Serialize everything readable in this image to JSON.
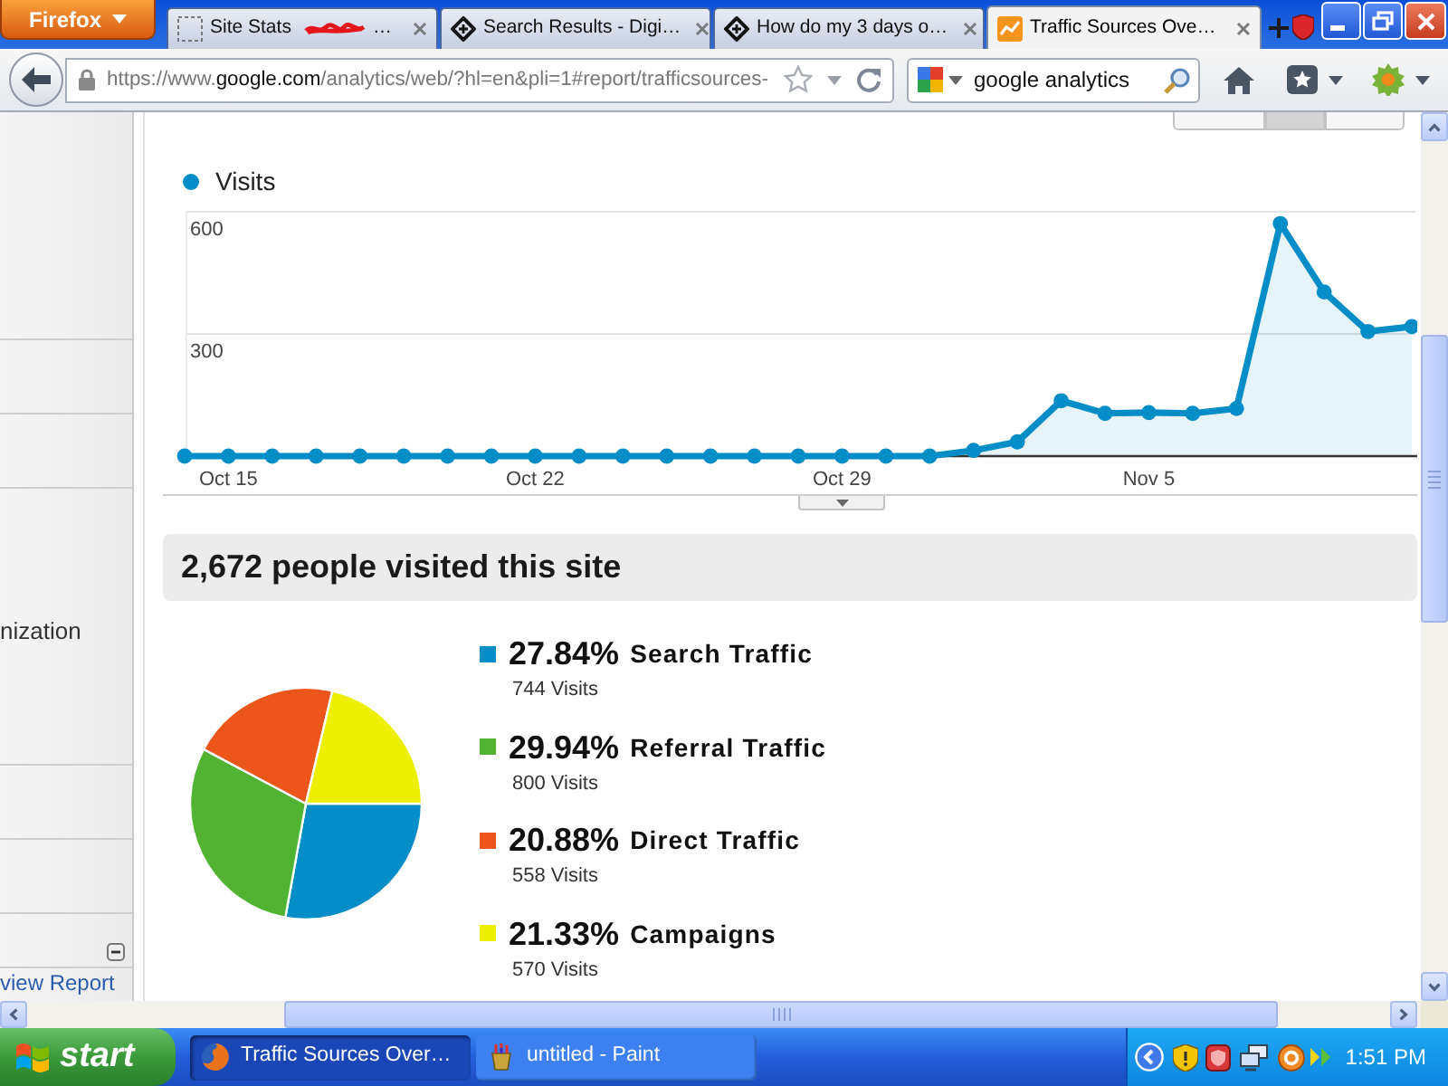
{
  "browser": {
    "menu_button": "Firefox",
    "tabs": [
      {
        "kind": "blank",
        "title": "Site Stats",
        "redacted": true,
        "tail": "…",
        "selected": false
      },
      {
        "kind": "diamond",
        "title": "Search Results - Digi…",
        "selected": false
      },
      {
        "kind": "diamond",
        "title": "How do my 3 days o…",
        "selected": false
      },
      {
        "kind": "chart",
        "title": "Traffic Sources Ove…",
        "selected": true
      }
    ],
    "address": {
      "scheme": "https://www.",
      "domain": "google.com",
      "path": "/analytics/web/?hl=en&pli=1#report/trafficsources-"
    },
    "search": {
      "value": "google analytics"
    }
  },
  "sidebar": {
    "item": "nization",
    "section_expanded": true,
    "link": "view Report"
  },
  "visits": {
    "view_toggle": [
      {
        "selected": false
      },
      {
        "selected": true
      },
      {
        "selected": false
      }
    ],
    "chart_data": {
      "type": "area",
      "categories": [
        null,
        "Oct 15",
        null,
        null,
        null,
        null,
        null,
        null,
        "Oct 22",
        null,
        null,
        null,
        null,
        null,
        null,
        "Oct 29",
        null,
        null,
        null,
        null,
        null,
        null,
        "Nov 5",
        null,
        null,
        null,
        null,
        null,
        null
      ],
      "ylim": [
        0,
        600
      ],
      "yticks": [
        {
          "value": 300,
          "label": "300"
        },
        {
          "value": 600,
          "label": "600"
        }
      ],
      "series": [
        {
          "name": "Visits",
          "color": "#058dc7",
          "values": [
            0,
            0,
            0,
            0,
            0,
            0,
            0,
            0,
            0,
            0,
            0,
            0,
            0,
            0,
            0,
            0,
            0,
            0,
            14,
            35,
            136,
            105,
            107,
            105,
            117,
            571,
            403,
            306,
            318
          ]
        }
      ]
    }
  },
  "traffic": {
    "title": "2,672 people visited this site",
    "chart_data": {
      "type": "pie",
      "categories": [
        "Search Traffic",
        "Referral Traffic",
        "Direct Traffic",
        "Campaigns"
      ],
      "values": [
        27.84,
        29.94,
        20.88,
        21.33
      ]
    },
    "legend": [
      {
        "percentage": "27.84%",
        "visits": "744 Visits",
        "color": "#058dc7"
      },
      {
        "percentage": "29.94%",
        "visits": "800 Visits",
        "color": "#50b432"
      },
      {
        "percentage": "20.88%",
        "visits": "558 Visits",
        "color": "#ed561b"
      },
      {
        "percentage": "21.33%",
        "visits": "570 Visits",
        "color": "#edef00"
      }
    ]
  },
  "taskbar": {
    "start": "start",
    "tasks": [
      {
        "kind": "browser",
        "label": "Traffic Sources Over…",
        "selected": true
      },
      {
        "kind": "paint",
        "label": "untitled - Paint",
        "selected": false
      }
    ],
    "clock": "1:51 PM"
  }
}
